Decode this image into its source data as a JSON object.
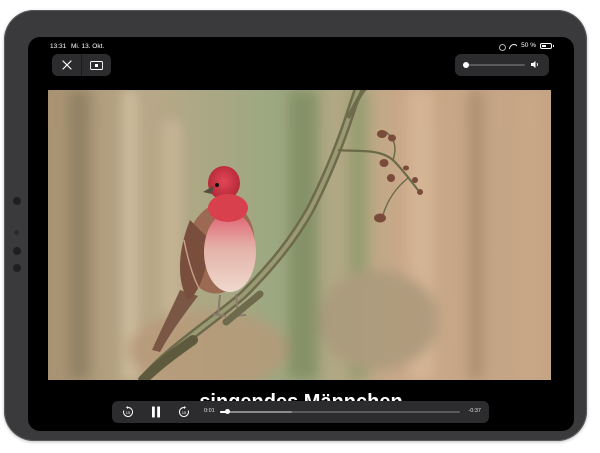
{
  "status_bar": {
    "time": "13:31",
    "date": "Mi. 13. Okt.",
    "battery_percent": "50 %"
  },
  "top_controls": {
    "close_icon": "close-icon",
    "pip_icon": "picture-in-picture-icon"
  },
  "volume": {
    "level": 0.05,
    "icon": "speaker-icon"
  },
  "video": {
    "subtitle": "singendes Männchen"
  },
  "playback": {
    "skip_back_icon": "skip-back-15-icon",
    "play_pause_icon": "pause-icon",
    "skip_forward_icon": "skip-forward-15-icon",
    "elapsed": "0:01",
    "remaining": "-0:37",
    "progress": 0.03,
    "buffered": 0.3
  },
  "colors": {
    "device_frame": "#3a3a3c",
    "control_bg": "#2c2c2e",
    "bird_red": "#d83a4a",
    "background_blur": "#b8a78a"
  }
}
